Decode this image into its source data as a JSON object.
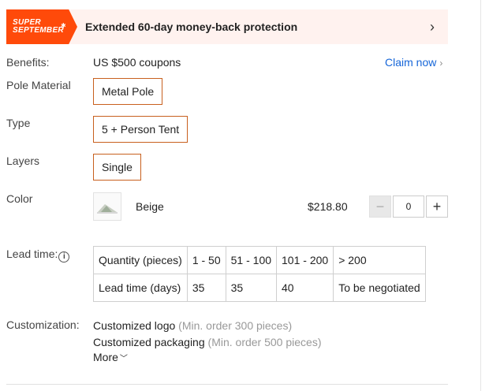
{
  "promo": {
    "tag_line1": "SUPER",
    "tag_line2": "SEPTEMBER",
    "text": "Extended 60-day money-back protection",
    "chevron_icon": "chevron-right-icon",
    "brand_color": "#ff4a0a"
  },
  "benefits": {
    "label": "Benefits:",
    "value": "US $500 coupons",
    "claim_label": "Claim now"
  },
  "pole_material": {
    "label": "Pole Material",
    "selected": "Metal Pole"
  },
  "type": {
    "label": "Type",
    "selected": "5 + Person Tent"
  },
  "layers": {
    "label": "Layers",
    "selected": "Single"
  },
  "color": {
    "label": "Color",
    "name": "Beige",
    "price": "$218.80",
    "quantity": "0",
    "thumbnail_icon": "tent-thumbnail",
    "minus_icon": "minus-icon",
    "plus_icon": "plus-icon"
  },
  "lead_time": {
    "label": "Lead time:",
    "info_icon": "info-icon",
    "header": [
      "Quantity (pieces)",
      "1 - 50",
      "51 - 100",
      "101 - 200",
      "> 200"
    ],
    "row": [
      "Lead time (days)",
      "35",
      "35",
      "40",
      "To be negotiated"
    ]
  },
  "customization": {
    "label": "Customization:",
    "items": [
      {
        "name": "Customized logo",
        "note": "(Min. order 300 pieces)"
      },
      {
        "name": "Customized packaging",
        "note": "(Min. order 500 pieces)"
      }
    ],
    "more_label": "More"
  }
}
